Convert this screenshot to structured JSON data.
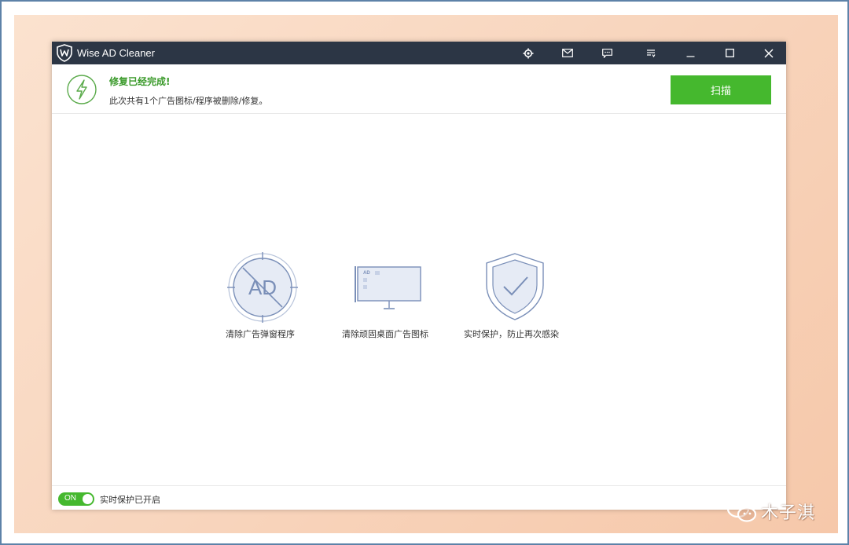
{
  "window": {
    "title": "Wise AD Cleaner"
  },
  "titlebar_icons": [
    "settings-icon",
    "mail-icon",
    "feedback-icon",
    "menu-icon",
    "minimize-icon",
    "maximize-icon",
    "close-icon"
  ],
  "header": {
    "status_title": "修复已经完成!",
    "status_detail": "此次共有1个广告图标/程序被删除/修复。",
    "scan_label": "扫描"
  },
  "features": [
    {
      "icon": "ad-blocked-icon",
      "label": "清除广告弹窗程序"
    },
    {
      "icon": "monitor-ad-icon",
      "label": "清除顽固桌面广告图标",
      "icon_text": "AD"
    },
    {
      "icon": "shield-check-icon",
      "label": "实时保护，防止再次感染"
    }
  ],
  "ad_icon_text": "AD",
  "footer": {
    "toggle_label": "ON",
    "protection_label": "实时保护已开启"
  },
  "watermark": {
    "text": "木子淇"
  },
  "colors": {
    "titlebar": "#2c3645",
    "accent_green": "#45b82e",
    "status_green": "#3a9a2a",
    "icon_blue": "#7a8fb8"
  }
}
